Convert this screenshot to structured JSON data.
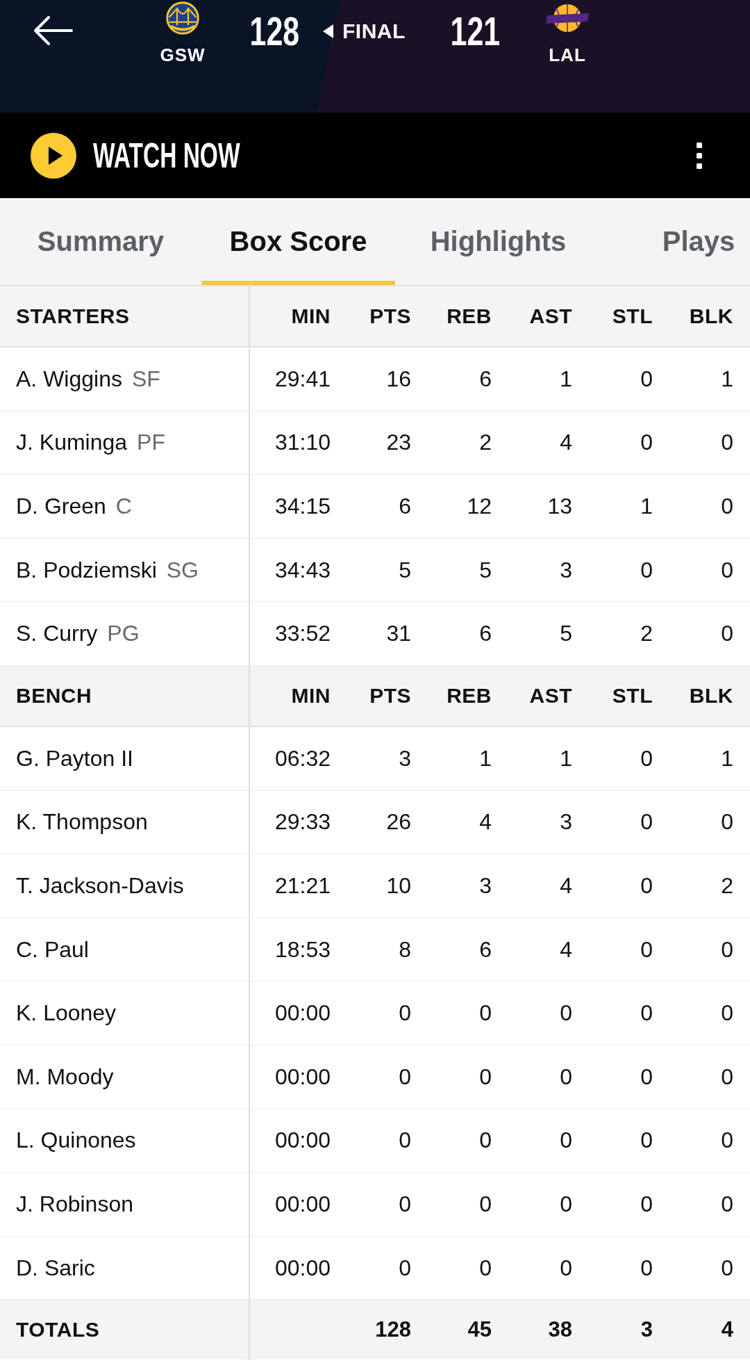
{
  "header": {
    "teams": [
      {
        "abbr": "GSW",
        "score": "128",
        "winner": true
      },
      {
        "abbr": "LAL",
        "score": "121",
        "winner": false
      }
    ],
    "status": "FINAL"
  },
  "watch": {
    "label": "WATCH NOW"
  },
  "tabs": [
    {
      "label": "Summary",
      "selected": false
    },
    {
      "label": "Box Score",
      "selected": true
    },
    {
      "label": "Highlights",
      "selected": false
    },
    {
      "label": "Plays",
      "selected": false
    }
  ],
  "box_score": {
    "sections": [
      {
        "title": "STARTERS",
        "columns": [
          "MIN",
          "PTS",
          "REB",
          "AST",
          "STL",
          "BLK"
        ],
        "players": [
          {
            "name": "A. Wiggins",
            "position": "SF",
            "stats": [
              "29:41",
              "16",
              "6",
              "1",
              "0",
              "1"
            ]
          },
          {
            "name": "J. Kuminga",
            "position": "PF",
            "stats": [
              "31:10",
              "23",
              "2",
              "4",
              "0",
              "0"
            ]
          },
          {
            "name": "D. Green",
            "position": "C",
            "stats": [
              "34:15",
              "6",
              "12",
              "13",
              "1",
              "0"
            ]
          },
          {
            "name": "B. Podziemski",
            "position": "SG",
            "stats": [
              "34:43",
              "5",
              "5",
              "3",
              "0",
              "0"
            ]
          },
          {
            "name": "S. Curry",
            "position": "PG",
            "stats": [
              "33:52",
              "31",
              "6",
              "5",
              "2",
              "0"
            ]
          }
        ]
      },
      {
        "title": "BENCH",
        "columns": [
          "MIN",
          "PTS",
          "REB",
          "AST",
          "STL",
          "BLK"
        ],
        "players": [
          {
            "name": "G. Payton II",
            "stats": [
              "06:32",
              "3",
              "1",
              "1",
              "0",
              "1"
            ]
          },
          {
            "name": "K. Thompson",
            "stats": [
              "29:33",
              "26",
              "4",
              "3",
              "0",
              "0"
            ]
          },
          {
            "name": "T. Jackson-Davis",
            "stats": [
              "21:21",
              "10",
              "3",
              "4",
              "0",
              "2"
            ]
          },
          {
            "name": "C. Paul",
            "stats": [
              "18:53",
              "8",
              "6",
              "4",
              "0",
              "0"
            ]
          },
          {
            "name": "K. Looney",
            "stats": [
              "00:00",
              "0",
              "0",
              "0",
              "0",
              "0"
            ]
          },
          {
            "name": "M. Moody",
            "stats": [
              "00:00",
              "0",
              "0",
              "0",
              "0",
              "0"
            ]
          },
          {
            "name": "L. Quinones",
            "stats": [
              "00:00",
              "0",
              "0",
              "0",
              "0",
              "0"
            ]
          },
          {
            "name": "J. Robinson",
            "stats": [
              "00:00",
              "0",
              "0",
              "0",
              "0",
              "0"
            ]
          },
          {
            "name": "D. Saric",
            "stats": [
              "00:00",
              "0",
              "0",
              "0",
              "0",
              "0"
            ]
          }
        ]
      }
    ],
    "totals": {
      "label": "TOTALS",
      "stats": [
        "128",
        "45",
        "38",
        "3",
        "4"
      ]
    }
  }
}
